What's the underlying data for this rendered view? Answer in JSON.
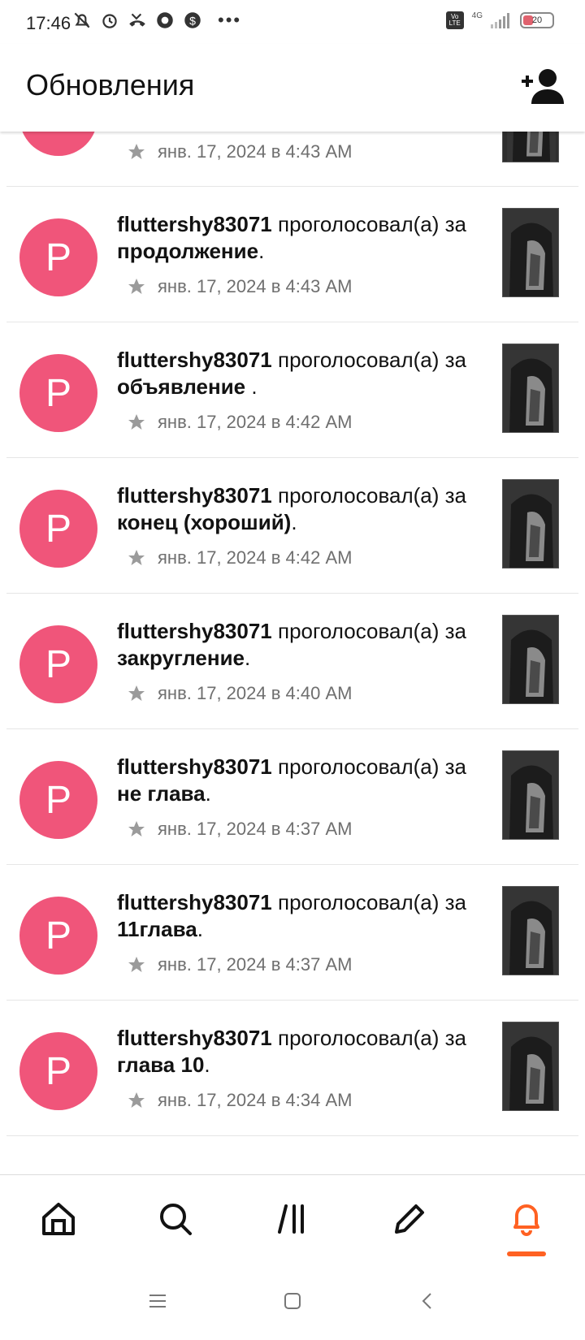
{
  "status_bar": {
    "time": "17:46",
    "network": "4G",
    "volte": "Vo LTE",
    "battery": "20"
  },
  "header": {
    "title": "Обновления"
  },
  "feed": {
    "first_partial_date": "янв. 17, 2024 в 4:43 AM",
    "items": [
      {
        "user": "fluttershy83071",
        "action": "проголосовал(а)",
        "prep": "за",
        "target": "продолжение",
        "end": ".",
        "date": "янв. 17, 2024 в 4:43 AM",
        "avatar_letter": "P"
      },
      {
        "user": "fluttershy83071",
        "action": "проголосовал(а)",
        "prep": "за",
        "target": "объявление ",
        "end": ".",
        "date": "янв. 17, 2024 в 4:42 AM",
        "avatar_letter": "P"
      },
      {
        "user": "fluttershy83071",
        "action": "проголосовал(а)",
        "prep": "за",
        "target": "конец (хороший)",
        "end": ".",
        "date": "янв. 17, 2024 в 4:42 AM",
        "avatar_letter": "P"
      },
      {
        "user": "fluttershy83071",
        "action": "проголосовал(а)",
        "prep": "за",
        "target": "закругление",
        "end": ".",
        "date": "янв. 17, 2024 в 4:40 AM",
        "avatar_letter": "P"
      },
      {
        "user": "fluttershy83071",
        "action": "проголосовал(а)",
        "prep": "за",
        "target": "не глава",
        "end": ".",
        "date": "янв. 17, 2024 в 4:37 AM",
        "avatar_letter": "P"
      },
      {
        "user": "fluttershy83071",
        "action": "проголосовал(а)",
        "prep": "за",
        "target": "11глава",
        "end": ".",
        "date": "янв. 17, 2024 в 4:37 AM",
        "avatar_letter": "P"
      },
      {
        "user": "fluttershy83071",
        "action": "проголосовал(а)",
        "prep": "за",
        "target": "глава 10",
        "end": ".",
        "date": "янв. 17, 2024 в 4:34 AM",
        "avatar_letter": "P"
      }
    ]
  },
  "bottom_nav": {
    "items": [
      "home-icon",
      "search-icon",
      "library-icon",
      "pencil-icon",
      "bell-icon"
    ],
    "active": "bell-icon",
    "accent_color": "#ff6122"
  },
  "colors": {
    "avatar_bg": "#f0557a",
    "meta_text": "#6f6f6f"
  }
}
